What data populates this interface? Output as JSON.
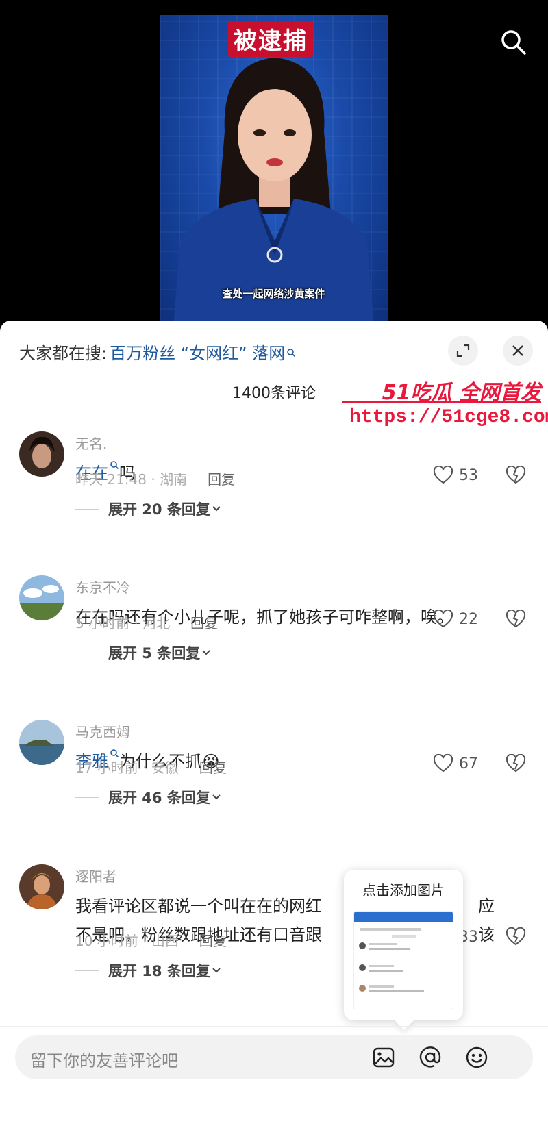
{
  "video": {
    "headline": "被逮捕",
    "caption": "查处一起网络涉黄案件"
  },
  "header": {
    "trend_prefix": "大家都在搜:",
    "trend_keyword": "百万粉丝 “女网红” 落网",
    "count_label": "1400条评论"
  },
  "watermark": {
    "brand": "51吃瓜 全网首发",
    "url": "https://51cge8.com"
  },
  "comments": [
    {
      "user": "无名.",
      "text_kw": "在在",
      "text_rest": "吗",
      "time_loc": "昨天 21:48 · 湖南",
      "reply": "回复",
      "likes": "53",
      "expand": "展开 20 条回复"
    },
    {
      "user": "东京不冷",
      "text_kw": "",
      "text_rest": "在在吗还有个小儿子呢，抓了她孩子可咋整啊，唉。",
      "time_loc": "5 小时前 · 河北",
      "reply": "回复",
      "likes": "22",
      "expand": "展开 5 条回复"
    },
    {
      "user": "马克西姆",
      "text_kw": "李雅",
      "text_rest": "为什么不抓😭",
      "time_loc": "17 小时前 · 安徽",
      "reply": "回复",
      "likes": "67",
      "expand": "展开 46 条回复"
    },
    {
      "user": "逐阳者",
      "text_kw": "",
      "text_line1": "我看评论区都说一个叫在在的网红",
      "text_line1_end": "应该",
      "text_line2": "不是吧，粉丝数跟地址还有口音跟",
      "time_loc": "10 小时前 · 山西",
      "reply": "回复",
      "likes": "33",
      "expand": "展开 18 条回复"
    }
  ],
  "popup": {
    "title": "点击添加图片"
  },
  "input": {
    "placeholder": "留下你的友善评论吧"
  },
  "colors": {
    "keyword_blue": "#1e5a9e",
    "watermark_red": "#e8193c"
  }
}
